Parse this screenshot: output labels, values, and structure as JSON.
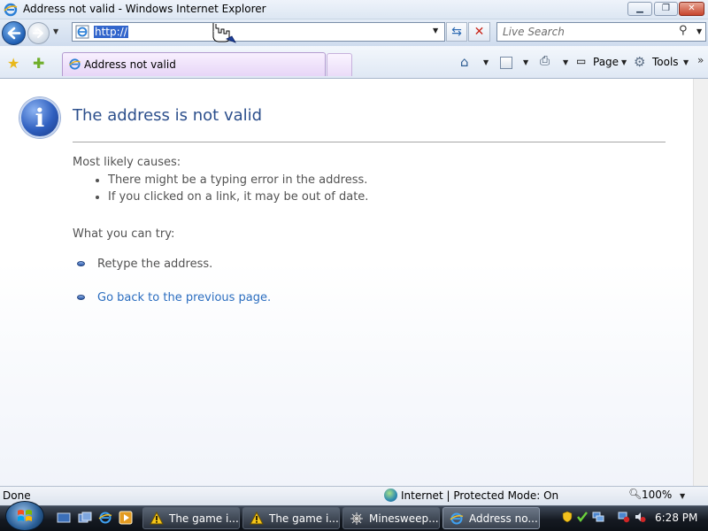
{
  "window": {
    "title": "Address not valid - Windows Internet Explorer"
  },
  "navigation": {
    "address_value": "http://",
    "search_placeholder": "Live Search"
  },
  "tab": {
    "label": "Address not valid"
  },
  "commands": {
    "page_label": "Page",
    "tools_label": "Tools"
  },
  "content": {
    "title": "The address is not valid",
    "causes_heading": "Most likely causes:",
    "causes": [
      "There might be a typing error in the address.",
      "If you clicked on a link, it may be out of date."
    ],
    "try_heading": "What you can try:",
    "retype": "Retype the address.",
    "go_back": "Go back to the previous page."
  },
  "status": {
    "text": "Done",
    "zone": "Internet | Protected Mode: On",
    "zoom": "100%"
  },
  "taskbar": {
    "items": [
      {
        "label": "The game i...",
        "icon": "warning-icon"
      },
      {
        "label": "The game i...",
        "icon": "warning-icon"
      },
      {
        "label": "Minesweep...",
        "icon": "minesweeper-icon"
      },
      {
        "label": "Address no...",
        "icon": "ie-icon"
      }
    ],
    "clock": "6:28 PM"
  },
  "colors": {
    "title_blue": "#2c4f8c",
    "link_blue": "#2a6dbf",
    "body_gray": "#525252"
  }
}
